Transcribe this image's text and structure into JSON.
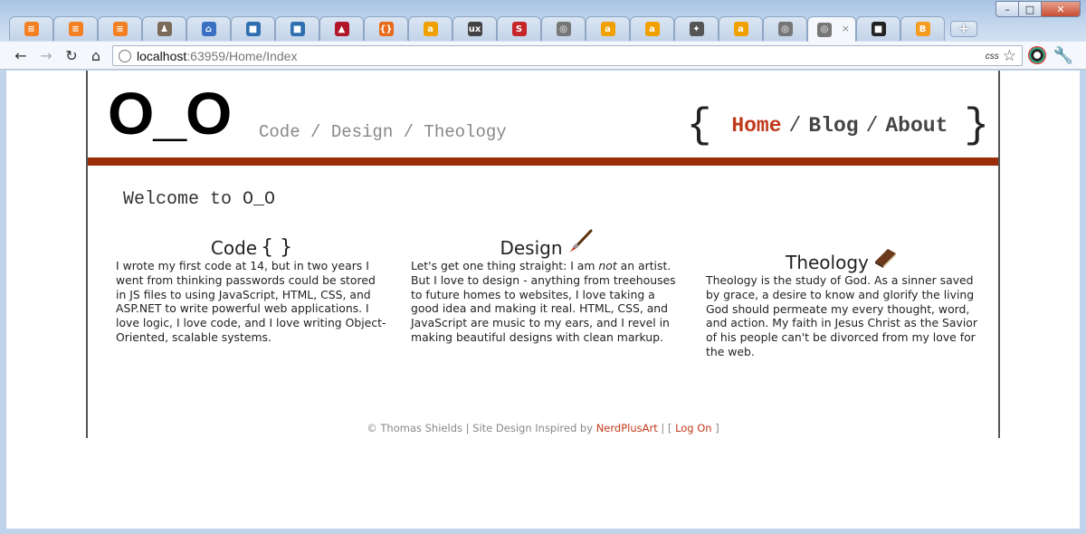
{
  "browser": {
    "url_host": "localhost",
    "url_rest": ":63959/Home/Index",
    "omnibox_ext_label": "css",
    "window_controls": [
      "–",
      "□",
      "✕"
    ],
    "tabs": [
      {
        "icon": "stackoverflow-icon",
        "color": "#f48024",
        "glyph": "≡"
      },
      {
        "icon": "stackoverflow-icon",
        "color": "#f48024",
        "glyph": "≡"
      },
      {
        "icon": "stackoverflow-icon",
        "color": "#f48024",
        "glyph": "≡"
      },
      {
        "icon": "user-avatar-icon",
        "color": "#7a6a5a",
        "glyph": "♟"
      },
      {
        "icon": "home-icon",
        "color": "#3a6fc4",
        "glyph": "⌂"
      },
      {
        "icon": "square-app-icon",
        "color": "#2f6fb0",
        "glyph": "■"
      },
      {
        "icon": "square-app-icon",
        "color": "#2f6fb0",
        "glyph": "■"
      },
      {
        "icon": "bird-icon",
        "color": "#b0182a",
        "glyph": "▲"
      },
      {
        "icon": "braces-icon",
        "color": "#e86a1a",
        "glyph": "{}"
      },
      {
        "icon": "amazon-icon",
        "color": "#f0a000",
        "glyph": "a"
      },
      {
        "icon": "ux-icon",
        "color": "#444444",
        "glyph": "ux"
      },
      {
        "icon": "s-icon",
        "color": "#c6252a",
        "glyph": "S"
      },
      {
        "icon": "globe-icon",
        "color": "#777777",
        "glyph": "◎"
      },
      {
        "icon": "amazon-icon",
        "color": "#f0a000",
        "glyph": "a"
      },
      {
        "icon": "amazon-icon",
        "color": "#f0a000",
        "glyph": "a"
      },
      {
        "icon": "gamepad-icon",
        "color": "#555555",
        "glyph": "✦"
      },
      {
        "icon": "amazon-icon",
        "color": "#f0a000",
        "glyph": "a"
      },
      {
        "icon": "globe-icon",
        "color": "#777777",
        "glyph": "◎"
      },
      {
        "icon": "globe-icon",
        "color": "#777777",
        "glyph": "◎",
        "active": true
      },
      {
        "icon": "dark-app-icon",
        "color": "#222222",
        "glyph": "■"
      },
      {
        "icon": "blogger-icon",
        "color": "#f59d22",
        "glyph": "B"
      }
    ]
  },
  "site": {
    "logo": "O_O",
    "tagline": "Code / Design / Theology",
    "nav": {
      "open_brace": "{",
      "close_brace": "}",
      "home": "Home",
      "blog": "Blog",
      "about": "About",
      "separator": "/"
    },
    "accent_color": "#9b2e0a",
    "link_color": "#c0391b",
    "welcome": "Welcome to O_O",
    "columns": {
      "code": {
        "title": "Code",
        "icon_glyph": "{ }",
        "text": "I wrote my first code at 14, but in two years I went from thinking passwords could be stored in JS files to using JavaScript, HTML, CSS, and ASP.NET to write powerful web applications. I love logic, I love code, and I love writing Object-Oriented, scalable systems."
      },
      "design": {
        "title": "Design",
        "icon": "paintbrush-icon",
        "text_before": "Let's get one thing straight: I am ",
        "text_em": "not",
        "text_after": " an artist. But I love to design - anything from treehouses to future homes to websites, I love taking a good idea and making it real. HTML, CSS, and JavaScript are music to my ears, and I revel in making beautiful designs with clean markup."
      },
      "theology": {
        "title": "Theology",
        "icon": "bible-icon",
        "text": "Theology is the study of God. As a sinner saved by grace, a desire to know and glorify the living God should permeate my every thought, word, and action. My faith in Jesus Christ as the Savior of his people can't be divorced from my love for the web."
      }
    },
    "footer": {
      "copyright": "© Thomas Shields | Site Design Inspired by ",
      "inspired_link": "NerdPlusArt",
      "sep_open": " | [ ",
      "logon": "Log On",
      "sep_close": " ]"
    }
  }
}
